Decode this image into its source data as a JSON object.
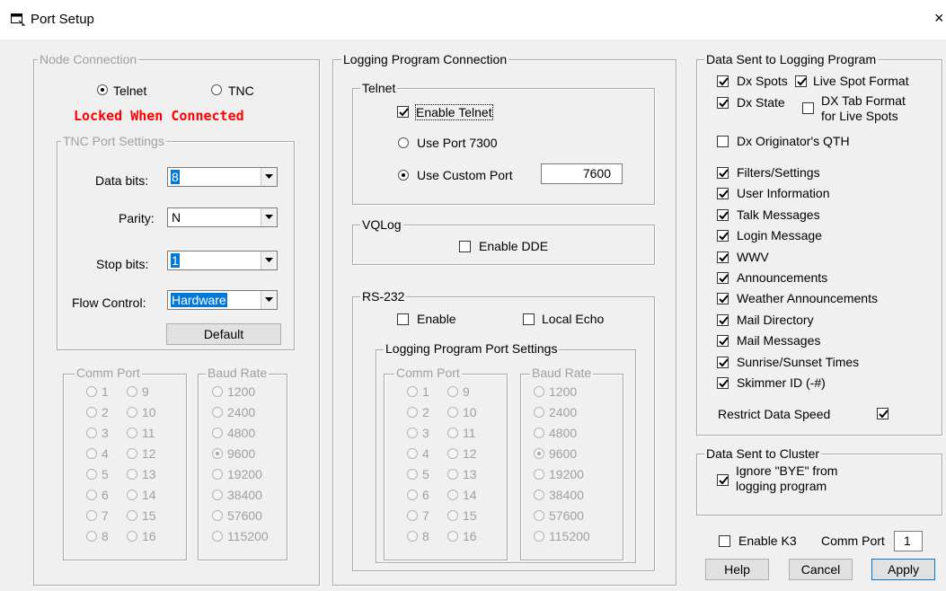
{
  "window": {
    "title": "Port Setup",
    "close_glyph": "×"
  },
  "node": {
    "group_label": "Node Connection",
    "telnet_label": "Telnet",
    "tnc_label": "TNC",
    "locked_text": "Locked When Connected",
    "tnc_group_label": "TNC Port Settings",
    "data_bits_label": "Data bits:",
    "data_bits_value": "8",
    "parity_label": "Parity:",
    "parity_value": "N",
    "stop_bits_label": "Stop bits:",
    "stop_bits_value": "1",
    "flow_label": "Flow Control:",
    "flow_value": "Hardware",
    "default_button": "Default",
    "comm_port_label": "Comm Port",
    "baud_rate_label": "Baud Rate",
    "comm_ports": [
      "1",
      "2",
      "3",
      "4",
      "5",
      "6",
      "7",
      "8",
      "9",
      "10",
      "11",
      "12",
      "13",
      "14",
      "15",
      "16"
    ],
    "baud_rates": [
      "1200",
      "2400",
      "4800",
      "9600",
      "19200",
      "38400",
      "57600",
      "115200"
    ],
    "baud_selected": "9600"
  },
  "logging": {
    "group_label": "Logging Program Connection",
    "telnet_group": "Telnet",
    "enable_telnet": "Enable Telnet",
    "use_port": "Use Port 7300",
    "use_custom": "Use Custom Port",
    "custom_port_value": "7600",
    "vqlog_group": "VQLog",
    "enable_dde": "Enable DDE",
    "rs232_group": "RS-232",
    "rs_enable": "Enable",
    "local_echo": "Local Echo",
    "lp_port_group": "Logging Program Port Settings",
    "comm_port_label": "Comm Port",
    "baud_rate_label": "Baud Rate",
    "comm_ports": [
      "1",
      "2",
      "3",
      "4",
      "5",
      "6",
      "7",
      "8",
      "9",
      "10",
      "11",
      "12",
      "13",
      "14",
      "15",
      "16"
    ],
    "baud_rates": [
      "1200",
      "2400",
      "4800",
      "9600",
      "19200",
      "38400",
      "57600",
      "115200"
    ],
    "baud_selected": "9600"
  },
  "data_sent": {
    "group_label": "Data Sent to Logging Program",
    "dx_spots": "Dx Spots",
    "live_spot_format": "Live Spot Format",
    "dx_state": "Dx State",
    "dx_tab_format_1": "DX Tab Format",
    "dx_tab_format_2": "for Live Spots",
    "dx_originator": "Dx Originator's QTH",
    "items": [
      "Filters/Settings",
      "User Information",
      "Talk Messages",
      "Login Message",
      "WWV",
      "Announcements",
      "Weather Announcements",
      "Mail Directory",
      "Mail Messages",
      "Sunrise/Sunset Times",
      "Skimmer ID (-#)"
    ],
    "restrict_label": "Restrict Data Speed"
  },
  "cluster": {
    "group_label": "Data Sent to Cluster",
    "ignore_bye_1": "Ignore \"BYE\" from",
    "ignore_bye_2": "logging program"
  },
  "k3": {
    "enable_label": "Enable K3",
    "comm_port_label": "Comm Port",
    "comm_port_value": "1"
  },
  "buttons": {
    "help": "Help",
    "cancel": "Cancel",
    "apply": "Apply"
  },
  "colors": {
    "locked_red": "#ff0000",
    "selection_blue": "#0078d7"
  }
}
